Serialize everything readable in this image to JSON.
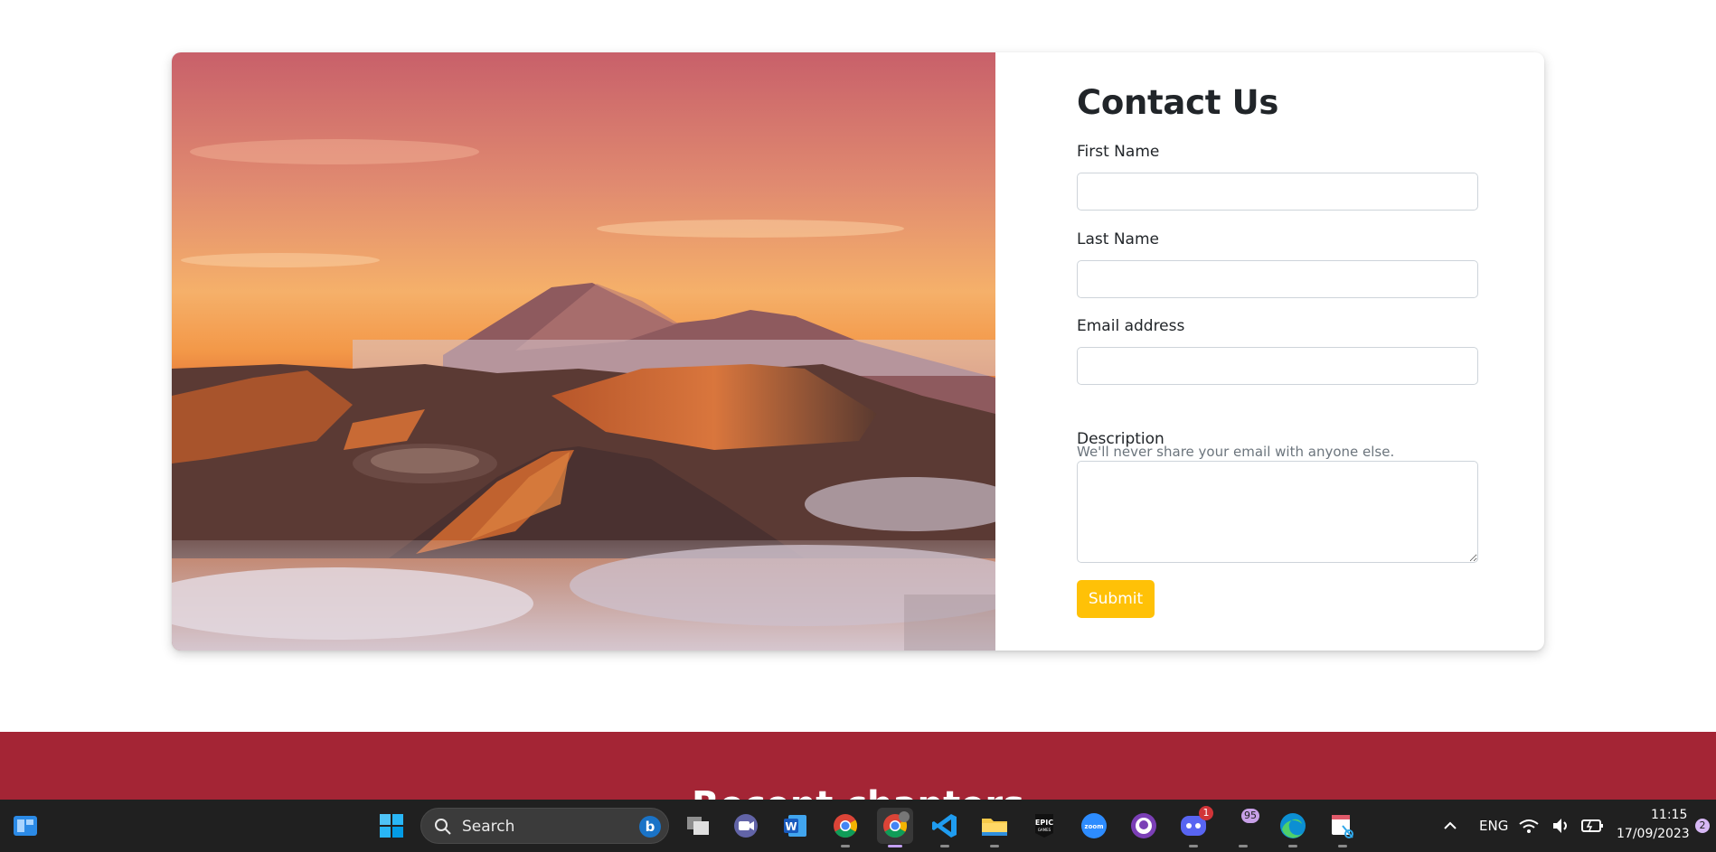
{
  "contact": {
    "title": "Contact Us",
    "first_name_label": "First Name",
    "first_name_value": "",
    "last_name_label": "Last Name",
    "last_name_value": "",
    "email_label": "Email address",
    "email_value": "",
    "email_hint": "We'll never share your email with anyone else.",
    "description_label": "Description",
    "description_value": "",
    "submit_label": "Submit",
    "image_icon": "volcano-landscape-image"
  },
  "next_section": {
    "heading": "Recent chapters"
  },
  "taskbar": {
    "search_label": "Search",
    "apps": [
      {
        "name": "task-view-icon"
      },
      {
        "name": "teams-meet-icon"
      },
      {
        "name": "word-icon"
      },
      {
        "name": "chrome-icon",
        "badge": ""
      },
      {
        "name": "chrome-profile-icon"
      },
      {
        "name": "vscode-icon"
      },
      {
        "name": "file-explorer-icon"
      },
      {
        "name": "epic-games-icon"
      },
      {
        "name": "zoom-icon"
      },
      {
        "name": "github-desktop-icon"
      },
      {
        "name": "discord-icon",
        "badge": "1"
      },
      {
        "name": "app-badge-icon",
        "badge": "95"
      },
      {
        "name": "edge-icon"
      },
      {
        "name": "snipping-tool-icon"
      }
    ],
    "language": "ENG",
    "time": "11:15",
    "date": "17/09/2023",
    "notification_count": "2"
  },
  "colors": {
    "accent_button": "#ffc107",
    "section_maroon": "#a42535",
    "taskbar_bg": "#202020"
  }
}
